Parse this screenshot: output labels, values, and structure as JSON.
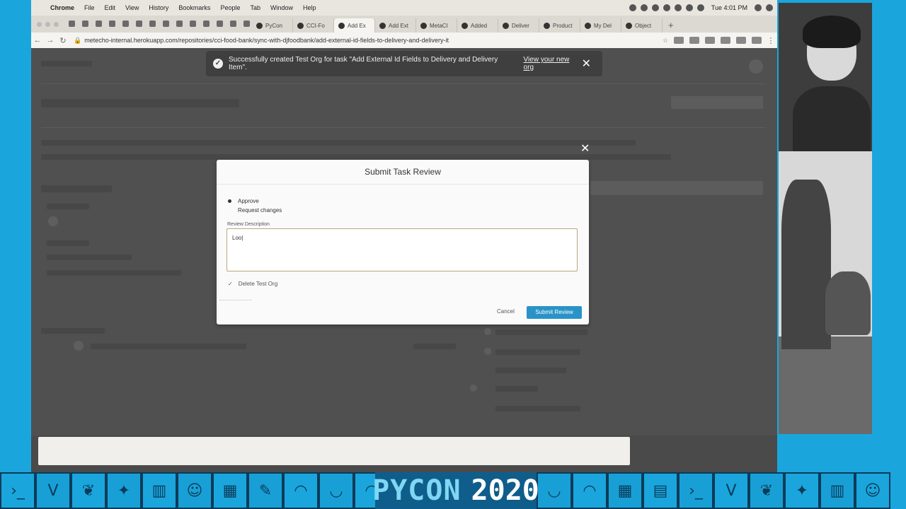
{
  "menubar": {
    "app": "Chrome",
    "items": [
      "File",
      "Edit",
      "View",
      "History",
      "Bookmarks",
      "People",
      "Tab",
      "Window",
      "Help"
    ],
    "clock": "Tue 4:01 PM"
  },
  "tabs": [
    {
      "label": "PyCon"
    },
    {
      "label": "CCI-Fo"
    },
    {
      "label": "Add Ex"
    },
    {
      "label": "Add Ext"
    },
    {
      "label": "MetaCI"
    },
    {
      "label": "Added"
    },
    {
      "label": "Deliver"
    },
    {
      "label": "Product"
    },
    {
      "label": "My Del"
    },
    {
      "label": "Object"
    }
  ],
  "new_tab": "+",
  "address": {
    "url": "metecho-internal.herokuapp.com/repositories/cci-food-bank/sync-with-djfoodbank/add-external-id-fields-to-delivery-and-delivery-it"
  },
  "toast": {
    "message": "Successfully created Test Org for task \"Add External Id Fields to Delivery and Delivery Item\".",
    "link": "View your new org",
    "close": "✕"
  },
  "modal": {
    "close": "✕",
    "title": "Submit Task Review",
    "options": [
      "Approve",
      "Request changes"
    ],
    "description_label": "Review Description",
    "description_value": "Loo|",
    "checkbox_label": "Delete Test Org",
    "cancel": "Cancel",
    "submit": "Submit Review"
  },
  "banner": {
    "word": "PYCON",
    "year": "2020"
  },
  "colors": {
    "frame": "#1aa6dc",
    "submit": "#2993c8",
    "banner_dark": "#0b3b59"
  }
}
